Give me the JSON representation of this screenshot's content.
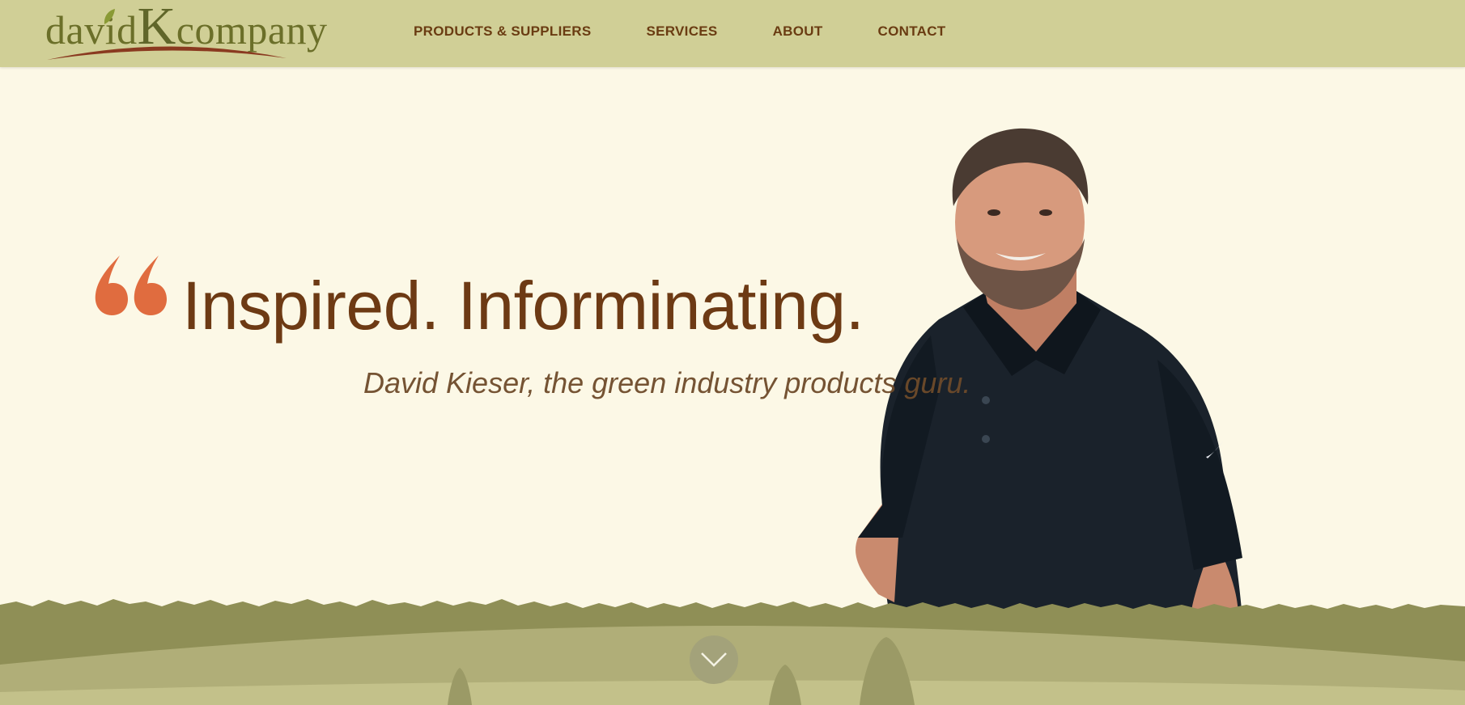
{
  "header": {
    "logo": {
      "text_left": "david",
      "text_k": "K",
      "text_right": "company"
    },
    "nav": [
      {
        "label": "PRODUCTS & SUPPLIERS"
      },
      {
        "label": "SERVICES"
      },
      {
        "label": "ABOUT"
      },
      {
        "label": "CONTACT"
      }
    ]
  },
  "hero": {
    "quote_icon": "open-quote-icon",
    "headline": "Inspired. Informinating.",
    "subline": "David Kieser, the green industry products guru.",
    "photo": "person-photo",
    "scroll_icon": "chevron-down-icon"
  },
  "colors": {
    "header_bg": "#d0cf96",
    "page_bg": "#fcf8e6",
    "nav_text": "#6a3c12",
    "headline": "#6d3a14",
    "quote_accent": "#e06c3f",
    "hill_dark": "#8f8f56",
    "hill_light": "#b0ae78"
  }
}
